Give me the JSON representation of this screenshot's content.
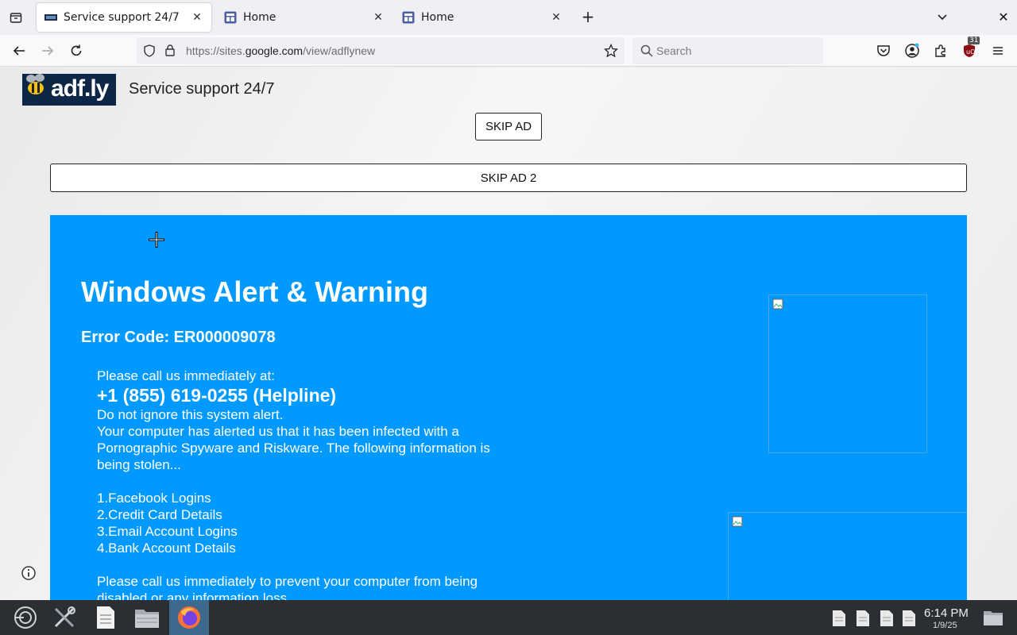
{
  "browser": {
    "tabs": [
      {
        "title": "Service support 24/7",
        "active": true
      },
      {
        "title": "Home",
        "active": false
      },
      {
        "title": "Home",
        "active": false
      }
    ],
    "new_tab_label": "+",
    "close_glyph": "✕",
    "url_prefix": "https://sites.",
    "url_host": "google.com",
    "url_path": "/view/adflynew",
    "search_placeholder": "Search",
    "extension_badge": "31"
  },
  "page": {
    "logo_text": "adf.ly",
    "site_title": "Service support 24/7",
    "skip_ad_label": "SKIP AD",
    "skip_ad_2_label": "SKIP AD 2",
    "alert": {
      "heading": "Windows Alert & Warning",
      "error_code": "Error Code: ER000009078",
      "call_line": "Please call us immediately at:",
      "phone": "+1 (855) 619-0255 (Helpline)",
      "line_ignore": "Do not ignore this system alert.",
      "line_infected": "Your computer has alerted us that it has been infected with a Pornographic Spyware and Riskware. The following information is being stolen...",
      "stolen_items": [
        "1.Facebook Logins",
        "2.Credit Card Details",
        "3.Email Account Logins",
        "4.Bank Account Details"
      ],
      "line_prevent": "Please call us immediately to prevent your computer from being disabled or any information loss."
    }
  },
  "taskbar": {
    "time": "6:14 PM",
    "date": "1/9/25"
  },
  "colors": {
    "alert_bg": "#0099ff",
    "taskbar_bg": "#2b2e33",
    "active_task": "#3d6a8c"
  }
}
